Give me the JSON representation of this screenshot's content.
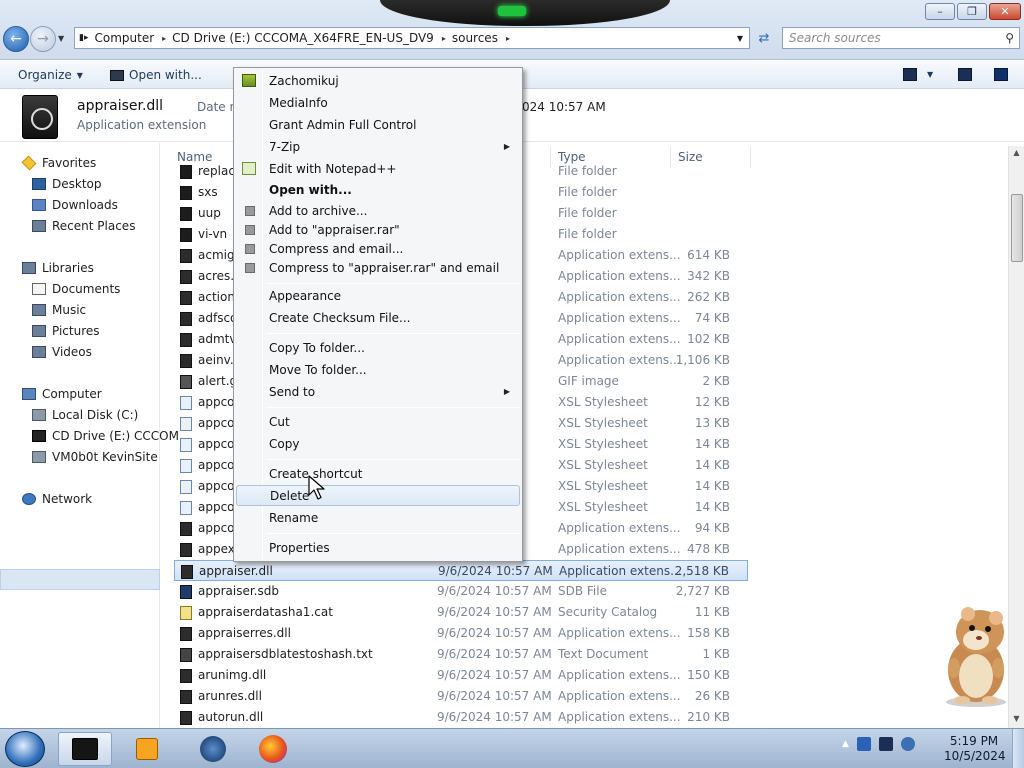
{
  "window": {
    "minimize": "–",
    "maximize": "❐",
    "close": "✕"
  },
  "address": {
    "segments": [
      "Computer",
      "CD Drive (E:) CCCOMA_X64FRE_EN-US_DV9",
      "sources"
    ],
    "search_placeholder": "Search sources"
  },
  "toolbar": {
    "organize": "Organize",
    "open_with": "Open with..."
  },
  "details": {
    "name": "appraiser.dll",
    "type": "Application extension",
    "modified_label": "Date m",
    "modified_value": "024 10:57 AM"
  },
  "sidebar": {
    "favorites": "Favorites",
    "desktop": "Desktop",
    "downloads": "Downloads",
    "recent": "Recent Places",
    "libraries": "Libraries",
    "documents": "Documents",
    "music": "Music",
    "pictures": "Pictures",
    "videos": "Videos",
    "computer": "Computer",
    "local_disk": "Local Disk (C:)",
    "cd_drive": "CD Drive (E:) CCCOM",
    "vm_share": "VM0b0t KevinSite",
    "network": "Network"
  },
  "columns": {
    "name": "Name",
    "type": "Type",
    "size": "Size"
  },
  "files": [
    {
      "name": "replace",
      "date": "M",
      "type": "File folder",
      "size": ""
    },
    {
      "name": "sxs",
      "date": "M",
      "type": "File folder",
      "size": ""
    },
    {
      "name": "uup",
      "date": "M",
      "type": "File folder",
      "size": ""
    },
    {
      "name": "vi-vn",
      "date": "M",
      "type": "File folder",
      "size": ""
    },
    {
      "name": "acmig",
      "date": "M",
      "type": "Application extens...",
      "size": "614 KB"
    },
    {
      "name": "acres.d",
      "date": "M",
      "type": "Application extens...",
      "size": "342 KB"
    },
    {
      "name": "action",
      "date": "M",
      "type": "Application extens...",
      "size": "262 KB"
    },
    {
      "name": "adfsco",
      "date": "M",
      "type": "Application extens...",
      "size": "74 KB"
    },
    {
      "name": "admtv.",
      "date": "M",
      "type": "Application extens...",
      "size": "102 KB"
    },
    {
      "name": "aeinv.d",
      "date": "M",
      "type": "Application extens...",
      "size": "1,106 KB"
    },
    {
      "name": "alert.gi",
      "date": "M",
      "type": "GIF image",
      "size": "2 KB"
    },
    {
      "name": "appcor",
      "date": "M",
      "type": "XSL Stylesheet",
      "size": "12 KB"
    },
    {
      "name": "appcor",
      "date": "M",
      "type": "XSL Stylesheet",
      "size": "13 KB"
    },
    {
      "name": "appcor",
      "date": "M",
      "type": "XSL Stylesheet",
      "size": "14 KB"
    },
    {
      "name": "appcor",
      "date": "M",
      "type": "XSL Stylesheet",
      "size": "14 KB"
    },
    {
      "name": "appcor",
      "date": "M",
      "type": "XSL Stylesheet",
      "size": "14 KB"
    },
    {
      "name": "appcor",
      "date": "M",
      "type": "XSL Stylesheet",
      "size": "14 KB"
    },
    {
      "name": "appcor",
      "date": "M",
      "type": "Application extens...",
      "size": "94 KB"
    },
    {
      "name": "appext",
      "date": "M",
      "type": "Application extens...",
      "size": "478 KB"
    },
    {
      "name": "appraiser.dll",
      "date": "9/6/2024 10:57 AM",
      "type": "Application extens...",
      "size": "2,518 KB"
    },
    {
      "name": "appraiser.sdb",
      "date": "9/6/2024 10:57 AM",
      "type": "SDB File",
      "size": "2,727 KB"
    },
    {
      "name": "appraiserdatasha1.cat",
      "date": "9/6/2024 10:57 AM",
      "type": "Security Catalog",
      "size": "11 KB"
    },
    {
      "name": "appraiserres.dll",
      "date": "9/6/2024 10:57 AM",
      "type": "Application extens...",
      "size": "158 KB"
    },
    {
      "name": "appraisersdblatestoshash.txt",
      "date": "9/6/2024 10:57 AM",
      "type": "Text Document",
      "size": "1 KB"
    },
    {
      "name": "arunimg.dll",
      "date": "9/6/2024 10:57 AM",
      "type": "Application extens...",
      "size": "150 KB"
    },
    {
      "name": "arunres.dll",
      "date": "9/6/2024 10:57 AM",
      "type": "Application extens...",
      "size": "26 KB"
    },
    {
      "name": "autorun.dll",
      "date": "9/6/2024 10:57 AM",
      "type": "Application extens...",
      "size": "210 KB"
    }
  ],
  "context_menu": {
    "zachomikuj": "Zachomikuj",
    "mediainfo": "MediaInfo",
    "grant_admin": "Grant Admin Full Control",
    "seven_zip": "7-Zip",
    "notepadpp": "Edit with Notepad++",
    "open_with": "Open with...",
    "add_archive": "Add to archive...",
    "add_rar": "Add to \"appraiser.rar\"",
    "compress_email": "Compress and email...",
    "compress_rar_email": "Compress to \"appraiser.rar\" and email",
    "appearance": "Appearance",
    "checksum": "Create Checksum File...",
    "copy_to": "Copy To folder...",
    "move_to": "Move To folder...",
    "send_to": "Send to",
    "cut": "Cut",
    "copy": "Copy",
    "create_shortcut": "Create shortcut",
    "delete": "Delete",
    "rename": "Rename",
    "properties": "Properties",
    "submenu_arrow": "▶"
  },
  "taskbar": {
    "time": "5:19 PM",
    "date": "10/5/2024",
    "tray_arrow": "▲"
  }
}
